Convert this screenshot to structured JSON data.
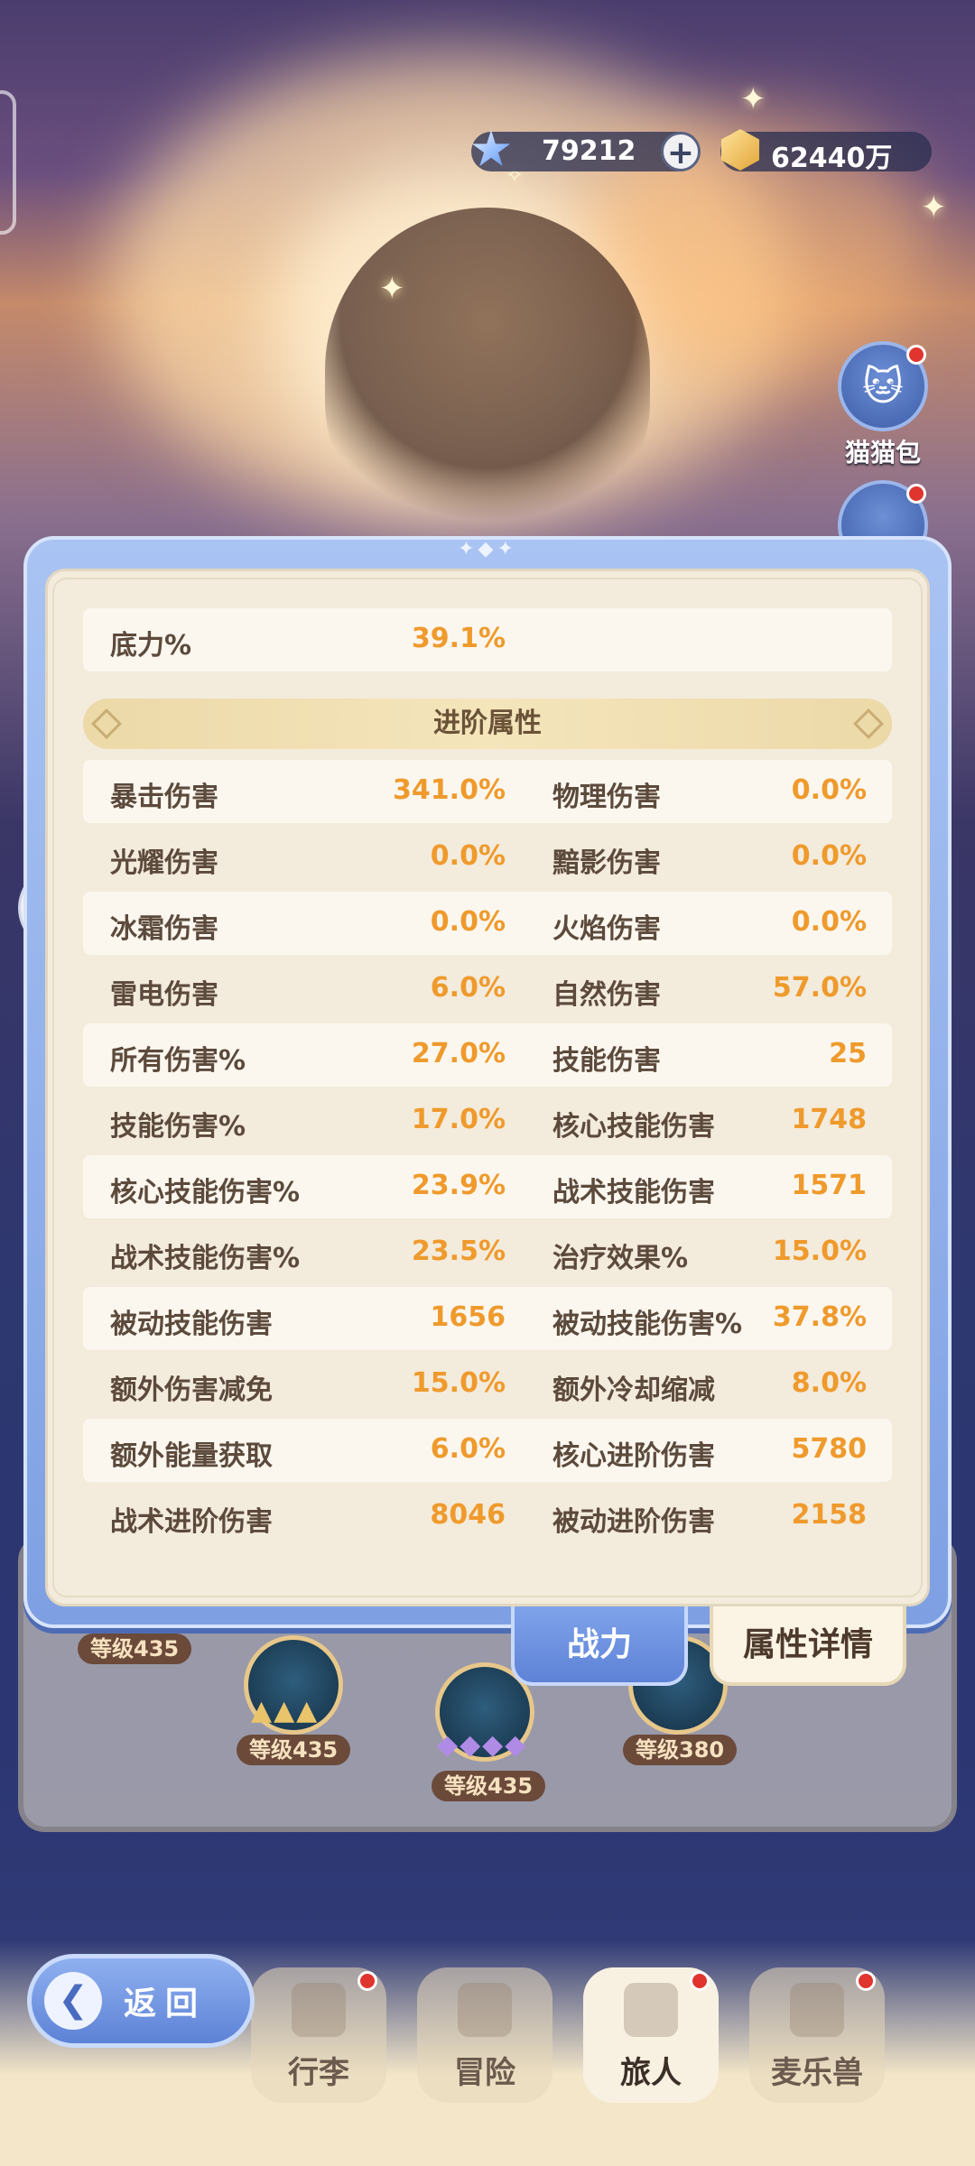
{
  "currency": {
    "gems": "79212",
    "gold": "62440万",
    "gem_icon": "star-gem-icon",
    "gold_icon": "gold-coin-icon",
    "plus_label": "+"
  },
  "side_buttons": {
    "cat_bag_label": "猫猫包"
  },
  "background": {
    "levels": [
      "等级435",
      "等级435",
      "等级435",
      "等级380"
    ]
  },
  "stats": {
    "base_label": "底力%",
    "base_value": "39.1%",
    "section_title": "进阶属性",
    "rows": [
      {
        "l1": "暴击伤害",
        "v1": "341.0%",
        "l2": "物理伤害",
        "v2": "0.0%"
      },
      {
        "l1": "光耀伤害",
        "v1": "0.0%",
        "l2": "黯影伤害",
        "v2": "0.0%"
      },
      {
        "l1": "冰霜伤害",
        "v1": "0.0%",
        "l2": "火焰伤害",
        "v2": "0.0%"
      },
      {
        "l1": "雷电伤害",
        "v1": "6.0%",
        "l2": "自然伤害",
        "v2": "57.0%"
      },
      {
        "l1": "所有伤害%",
        "v1": "27.0%",
        "l2": "技能伤害",
        "v2": "25"
      },
      {
        "l1": "技能伤害%",
        "v1": "17.0%",
        "l2": "核心技能伤害",
        "v2": "1748"
      },
      {
        "l1": "核心技能伤害%",
        "v1": "23.9%",
        "l2": "战术技能伤害",
        "v2": "1571"
      },
      {
        "l1": "战术技能伤害%",
        "v1": "23.5%",
        "l2": "治疗效果%",
        "v2": "15.0%"
      },
      {
        "l1": "被动技能伤害",
        "v1": "1656",
        "l2": "被动技能伤害%",
        "v2": "37.8%"
      },
      {
        "l1": "额外伤害减免",
        "v1": "15.0%",
        "l2": "额外冷却缩减",
        "v2": "8.0%"
      },
      {
        "l1": "额外能量获取",
        "v1": "6.0%",
        "l2": "核心进阶伤害",
        "v2": "5780"
      },
      {
        "l1": "战术进阶伤害",
        "v1": "8046",
        "l2": "被动进阶伤害",
        "v2": "2158"
      }
    ]
  },
  "tabs": {
    "power": "战力",
    "detail": "属性详情"
  },
  "nav": {
    "back": "返回",
    "items": [
      "行李",
      "冒险",
      "旅人",
      "麦乐兽"
    ]
  },
  "colors": {
    "value_orange": "#ef9a2c",
    "label_brown": "#5c4a3c",
    "dialog_blue": "#7ea0e3",
    "panel_cream": "#f3ebdc"
  }
}
